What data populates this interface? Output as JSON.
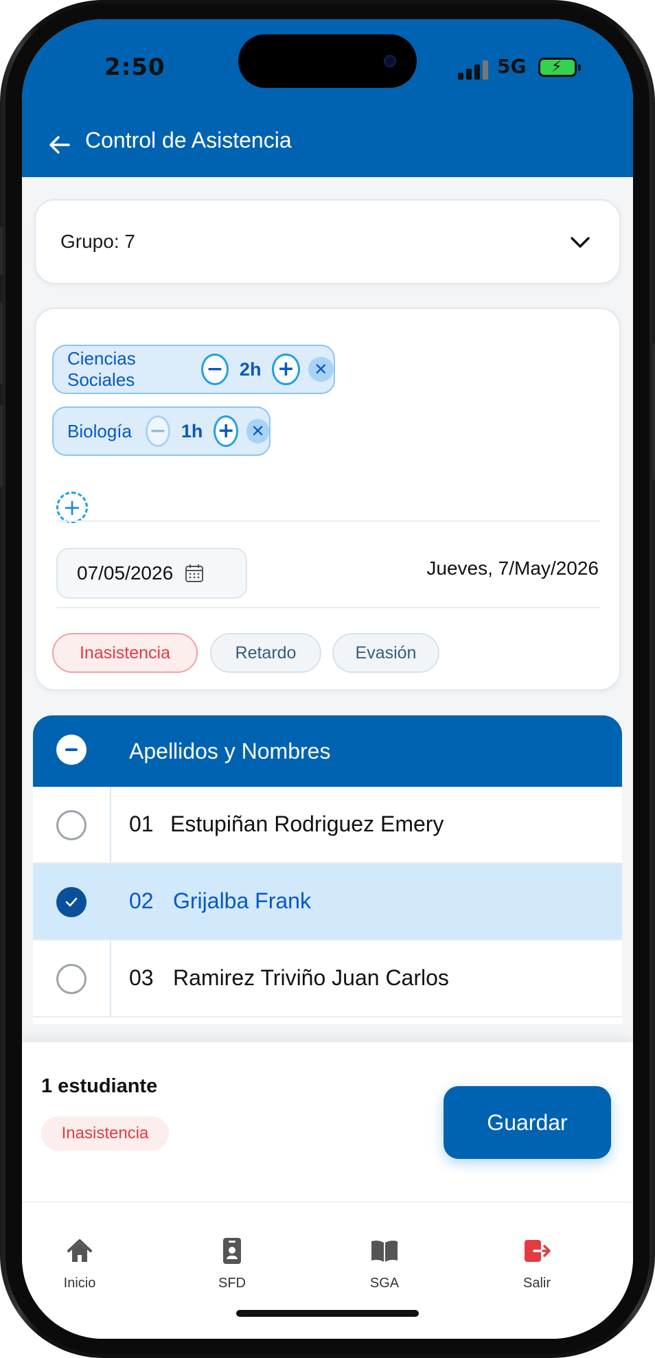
{
  "status_bar": {
    "time": "2:50",
    "network": "5G"
  },
  "header": {
    "title": "Control de Asistencia"
  },
  "group_selector": {
    "label": "Grupo: 7"
  },
  "subjects": [
    {
      "name": "Ciencias Sociales",
      "hours": "2h"
    },
    {
      "name": "Biología",
      "hours": "1h"
    }
  ],
  "date": {
    "value": "07/05/2026",
    "long": "Jueves, 7/May/2026"
  },
  "attendance_types": [
    {
      "label": "Inasistencia",
      "active": true
    },
    {
      "label": "Retardo",
      "active": false
    },
    {
      "label": "Evasión",
      "active": false
    }
  ],
  "table": {
    "header": "Apellidos y Nombres",
    "rows": [
      {
        "number": "01",
        "name": "Estupiñan Rodriguez Emery",
        "selected": false
      },
      {
        "number": "02",
        "name": "Grijalba Frank",
        "selected": true
      },
      {
        "number": "03",
        "name": "Ramirez Triviño Juan Carlos",
        "selected": false
      }
    ]
  },
  "summary": {
    "count": "1 estudiante",
    "type": "Inasistencia",
    "save_label": "Guardar"
  },
  "nav": [
    {
      "label": "Inicio",
      "icon": "home-icon"
    },
    {
      "label": "SFD",
      "icon": "id-badge-icon"
    },
    {
      "label": "SGA",
      "icon": "book-icon"
    },
    {
      "label": "Salir",
      "icon": "logout-icon"
    }
  ],
  "colors": {
    "primary": "#0063b1",
    "selected_row": "#d1e9fb",
    "danger": "#e53a3f"
  }
}
